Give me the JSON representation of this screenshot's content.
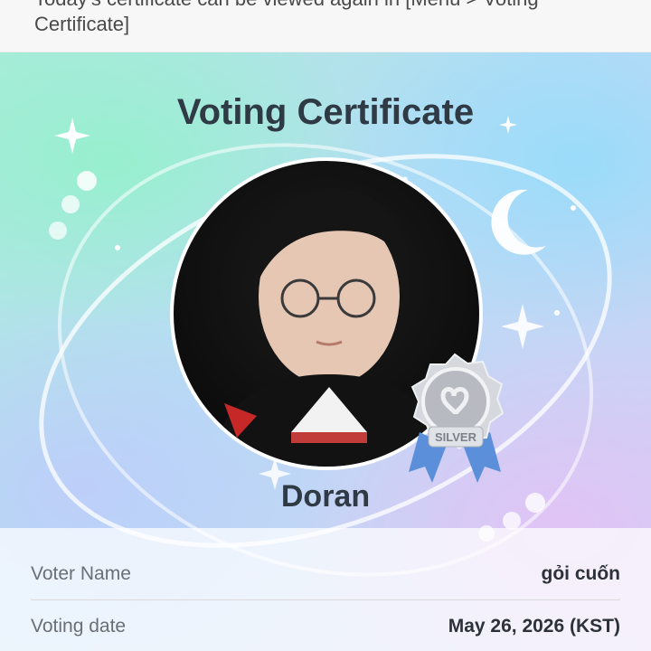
{
  "notice": {
    "line1": "Today's certificate can be viewed again in [Menu > Voting",
    "line2": "Certificate]"
  },
  "certificate": {
    "title": "Voting Certificate",
    "candidate_name": "Doran",
    "badge_label": "SILVER"
  },
  "details": [
    {
      "label": "Voter Name",
      "value": "gỏi cuốn"
    },
    {
      "label": "Voting date",
      "value": "May 26, 2026 (KST)"
    }
  ],
  "colors": {
    "title_text": "#2f3a44",
    "badge_silver": "#c9ccd1",
    "ribbon_blue": "#5b8fd9"
  }
}
